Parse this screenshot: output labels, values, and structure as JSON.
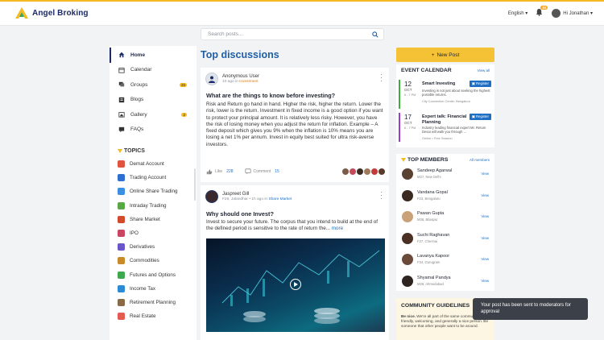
{
  "brand": {
    "name": "Angel Broking",
    "accent": "#f5b921",
    "primary": "#1c2a66",
    "link": "#1e6fc4"
  },
  "header": {
    "language": "English",
    "notification_count": "34",
    "user_greeting": "Hi Jonathan"
  },
  "search": {
    "placeholder": "Search posts..."
  },
  "sidebar": {
    "items": [
      {
        "label": "Home",
        "icon": "home-icon",
        "active": true
      },
      {
        "label": "Calendar",
        "icon": "calendar-icon"
      },
      {
        "label": "Groups",
        "icon": "groups-icon",
        "badge": "25"
      },
      {
        "label": "Blogs",
        "icon": "blog-icon"
      },
      {
        "label": "Gallery",
        "icon": "gallery-icon",
        "badge": "2"
      },
      {
        "label": "FAQs",
        "icon": "faq-icon"
      }
    ],
    "topics_title": "TOPICS",
    "topics": [
      {
        "label": "Demat Account",
        "color": "#e0533e"
      },
      {
        "label": "Trading Account",
        "color": "#2e6fd1"
      },
      {
        "label": "Online Share Trading",
        "color": "#3c8fe0"
      },
      {
        "label": "Intraday Trading",
        "color": "#58a845"
      },
      {
        "label": "Share Market",
        "color": "#d2492c"
      },
      {
        "label": "IPO",
        "color": "#c94560"
      },
      {
        "label": "Derivatives",
        "color": "#6a56c9"
      },
      {
        "label": "Commodities",
        "color": "#c98a2a"
      },
      {
        "label": "Futures and Options",
        "color": "#3da84e"
      },
      {
        "label": "Income Tax",
        "color": "#2d8bd6"
      },
      {
        "label": "Retirement Planning",
        "color": "#8a6a45"
      },
      {
        "label": "Real Estate",
        "color": "#e45a4f"
      }
    ]
  },
  "feed": {
    "title": "Top discussions",
    "posts": [
      {
        "author": "Anonymous User",
        "meta_prefix": "10 ago in",
        "meta_tag": "Investment",
        "question": "What are the things to know before investing?",
        "body": "Risk and Return go hand in hand. Higher the risk, higher the return. Lower the risk, lower is the return. Investment in fixed income is a good option if you want to protect your principal amount. It is relatively less risky. However, you have the risk of losing money when you adjust the return for inflation. Example – A fixed deposit which gives you 9% when the inflation is 10% means you are losing a net 1% per annum. Invest in equity best suited for ultra risk-averse investors.",
        "like_label": "Like",
        "like_count": "228",
        "comment_label": "Comment",
        "comment_count": "15"
      },
      {
        "author": "Jaspreet Gill",
        "meta_prefix": "F26, Jalandhar • 1h ago in",
        "meta_tag": "Share Market",
        "question": "Why should one Invest?",
        "body": "Invest to secure your future. The corpus that you intend to build at the end of the defined period is sensitive to the rate of return the...",
        "more": "more"
      }
    ]
  },
  "right": {
    "new_post_label": "New Post",
    "events_title": "EVENT CALENDAR",
    "events_link": "View all",
    "events": [
      {
        "day": "12",
        "month": "OCT",
        "time": "6 - 7 PM",
        "title": "Smart Investing",
        "register": "Register",
        "desc": "Investing is not just about seeking the highest possible returns.",
        "location": "City Convention Center, Bengaluru",
        "color": "#3cae3c"
      },
      {
        "day": "17",
        "month": "OCT",
        "time": "6 - 7 PM",
        "title": "Expert talk: Financial Planning",
        "register": "Register",
        "desc": "Industry leading financial expert Mr. Retum Desai will walk you through ...",
        "location": "Online • Free Session",
        "color": "#9b3bc9"
      }
    ],
    "members_title": "TOP MEMBERS",
    "members_link": "All members",
    "members": [
      {
        "name": "Sandeep Agarwal",
        "loc": "M27, New Delhi",
        "view": "View",
        "color": "#5a4030"
      },
      {
        "name": "Vandana Gopal",
        "loc": "F23, Bengaluru",
        "view": "View",
        "color": "#3a2a22"
      },
      {
        "name": "Pawan Gupta",
        "loc": "M36, Bilaspur",
        "view": "View",
        "color": "#c9a27a"
      },
      {
        "name": "Suchi Raghavan",
        "loc": "F27, Chennai",
        "view": "View",
        "color": "#4a3025"
      },
      {
        "name": "Lavanya Kapoor",
        "loc": "F34, Gurugram",
        "view": "View",
        "color": "#6b4a3a"
      },
      {
        "name": "Shyamal Pandya",
        "loc": "M28, Ahmedabad",
        "view": "View",
        "color": "#2f2520"
      }
    ],
    "guidelines_title": "COMMUNITY GUIDELINES",
    "guidelines_lead": "Be nice.",
    "guidelines_text": " We're all part of the same community, so be friendly, welcoming, and generally a nice person. Be someone that other people want to be around."
  },
  "toast": {
    "message": "Your post has been sent to moderators for approval"
  }
}
